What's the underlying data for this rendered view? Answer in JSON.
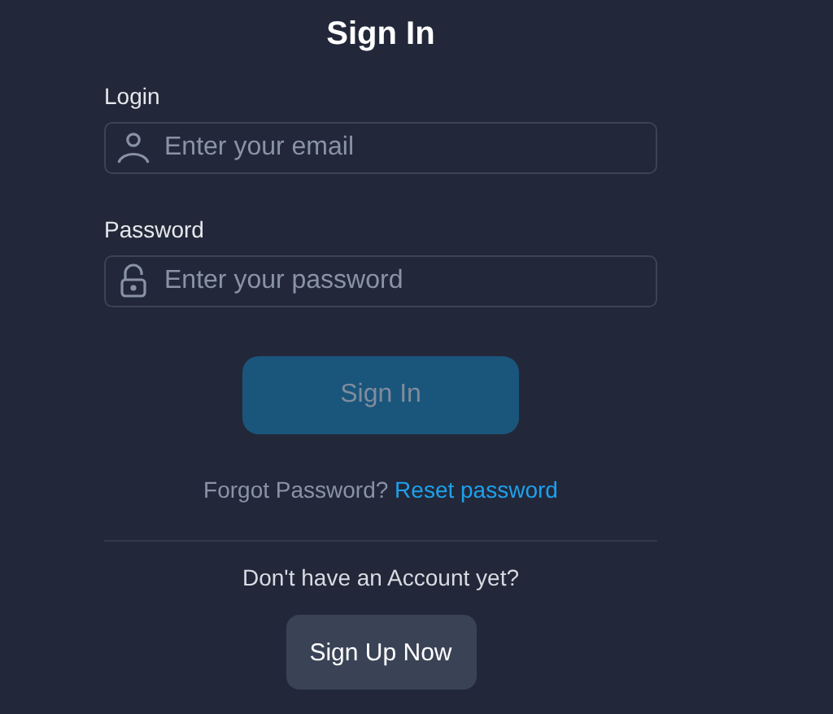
{
  "title": "Sign In",
  "fields": [
    {
      "kind": "email",
      "label": "Login",
      "placeholder": "Enter your email"
    },
    {
      "kind": "password",
      "label": "Password",
      "placeholder": "Enter your password"
    }
  ],
  "submit": {
    "label": "Sign In",
    "disabled": true
  },
  "forgot": {
    "text": "Forgot Password?",
    "link": "Reset password"
  },
  "signup": {
    "prompt": "Don't have an Account yet?",
    "button": "Sign Up Now"
  }
}
